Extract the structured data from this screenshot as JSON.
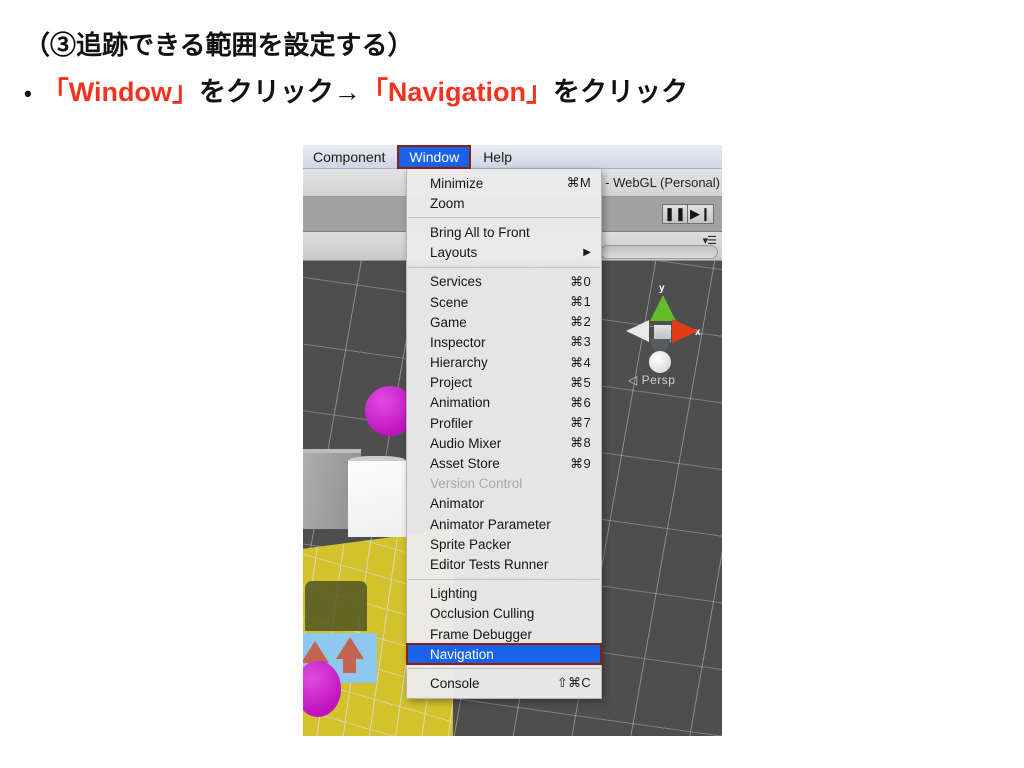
{
  "slide": {
    "heading_line1": "（③追跡できる範囲を設定する）",
    "bullet": "•",
    "line2_part1": "「Window」",
    "line2_part2": " をクリック→",
    "line2_part3": "「Navigation」",
    "line2_part4": " をクリック",
    "accent_color": "#f4331f"
  },
  "unity": {
    "menubar": {
      "items": [
        {
          "label": "Component",
          "selected": false
        },
        {
          "label": "Window",
          "selected": true
        },
        {
          "label": "Help",
          "selected": false
        }
      ]
    },
    "titlebar": {
      "text": "- WebGL (Personal)"
    },
    "toolbar": {
      "pause_icon": "❚❚",
      "step_icon": "▶❙"
    },
    "tabbar": {
      "hamburger_icon": "▾☰",
      "search_placeholder": ""
    },
    "scene": {
      "gizmo": {
        "axis_y_label": "y",
        "axis_x_label": "x",
        "projection_label": "◁ Persp"
      }
    }
  },
  "window_menu": {
    "groups": [
      {
        "items": [
          {
            "label": "Minimize",
            "shortcut": "⌘M",
            "disabled": false,
            "selected": false,
            "submenu": false
          },
          {
            "label": "Zoom",
            "shortcut": "",
            "disabled": false,
            "selected": false,
            "submenu": false
          }
        ]
      },
      {
        "items": [
          {
            "label": "Bring All to Front",
            "shortcut": "",
            "disabled": false,
            "selected": false,
            "submenu": false
          },
          {
            "label": "Layouts",
            "shortcut": "",
            "disabled": false,
            "selected": false,
            "submenu": true
          }
        ]
      },
      {
        "items": [
          {
            "label": "Services",
            "shortcut": "⌘0",
            "disabled": false,
            "selected": false,
            "submenu": false
          },
          {
            "label": "Scene",
            "shortcut": "⌘1",
            "disabled": false,
            "selected": false,
            "submenu": false
          },
          {
            "label": "Game",
            "shortcut": "⌘2",
            "disabled": false,
            "selected": false,
            "submenu": false
          },
          {
            "label": "Inspector",
            "shortcut": "⌘3",
            "disabled": false,
            "selected": false,
            "submenu": false
          },
          {
            "label": "Hierarchy",
            "shortcut": "⌘4",
            "disabled": false,
            "selected": false,
            "submenu": false
          },
          {
            "label": "Project",
            "shortcut": "⌘5",
            "disabled": false,
            "selected": false,
            "submenu": false
          },
          {
            "label": "Animation",
            "shortcut": "⌘6",
            "disabled": false,
            "selected": false,
            "submenu": false
          },
          {
            "label": "Profiler",
            "shortcut": "⌘7",
            "disabled": false,
            "selected": false,
            "submenu": false
          },
          {
            "label": "Audio Mixer",
            "shortcut": "⌘8",
            "disabled": false,
            "selected": false,
            "submenu": false
          },
          {
            "label": "Asset Store",
            "shortcut": "⌘9",
            "disabled": false,
            "selected": false,
            "submenu": false
          },
          {
            "label": "Version Control",
            "shortcut": "",
            "disabled": true,
            "selected": false,
            "submenu": false
          },
          {
            "label": "Animator",
            "shortcut": "",
            "disabled": false,
            "selected": false,
            "submenu": false
          },
          {
            "label": "Animator Parameter",
            "shortcut": "",
            "disabled": false,
            "selected": false,
            "submenu": false
          },
          {
            "label": "Sprite Packer",
            "shortcut": "",
            "disabled": false,
            "selected": false,
            "submenu": false
          },
          {
            "label": "Editor Tests Runner",
            "shortcut": "",
            "disabled": false,
            "selected": false,
            "submenu": false
          }
        ]
      },
      {
        "items": [
          {
            "label": "Lighting",
            "shortcut": "",
            "disabled": false,
            "selected": false,
            "submenu": false
          },
          {
            "label": "Occlusion Culling",
            "shortcut": "",
            "disabled": false,
            "selected": false,
            "submenu": false
          },
          {
            "label": "Frame Debugger",
            "shortcut": "",
            "disabled": false,
            "selected": false,
            "submenu": false
          },
          {
            "label": "Navigation",
            "shortcut": "",
            "disabled": false,
            "selected": true,
            "submenu": false
          }
        ]
      },
      {
        "items": [
          {
            "label": "Console",
            "shortcut": "⇧⌘C",
            "disabled": false,
            "selected": false,
            "submenu": false
          }
        ]
      }
    ]
  }
}
